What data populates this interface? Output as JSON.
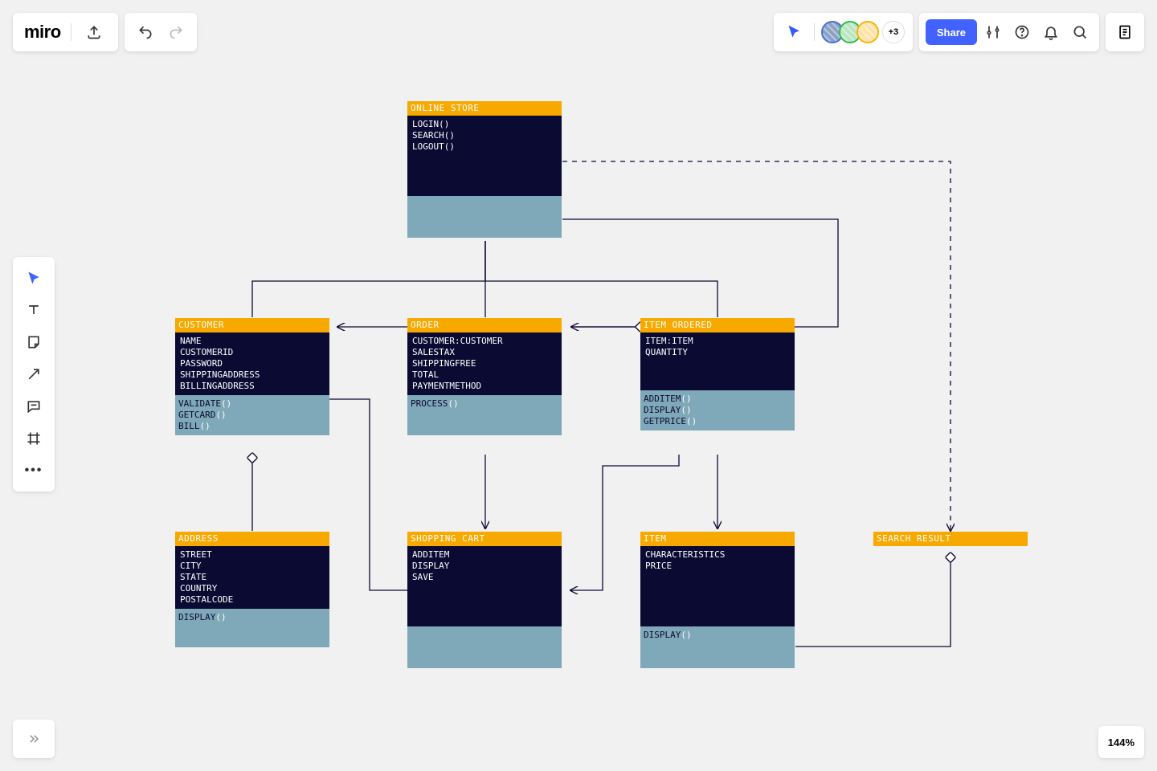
{
  "app": {
    "logo": "miro"
  },
  "presence": {
    "overflow": "+3"
  },
  "share": {
    "label": "Share"
  },
  "zoom": {
    "level": "144%"
  },
  "boxes": {
    "online_store": {
      "title": "ONLINE STORE",
      "attrs": [
        "LOGIN()",
        "SEARCH()",
        "LOGOUT()"
      ],
      "methods": []
    },
    "customer": {
      "title": "CUSTOMER",
      "attrs": [
        "NAME",
        "CUSTOMERID",
        "PASSWORD",
        "SHIPPINGADDRESS",
        "BILLINGADDRESS"
      ],
      "methods": [
        "VALIDATE()",
        "GETCARD()",
        "BILL()"
      ]
    },
    "order": {
      "title": "ORDER",
      "attrs": [
        "CUSTOMER:CUSTOMER",
        "SALESTAX",
        "SHIPPINGFREE",
        "TOTAL",
        "PAYMENTMETHOD"
      ],
      "methods": [
        "PROCESS()"
      ]
    },
    "item_ordered": {
      "title": "ITEM ORDERED",
      "attrs": [
        "ITEM:ITEM",
        "QUANTITY"
      ],
      "methods": [
        "ADDITEM()",
        "DISPLAY()",
        "GETPRICE()"
      ]
    },
    "address": {
      "title": "ADDRESS",
      "attrs": [
        "STREET",
        "CITY",
        "STATE",
        "COUNTRY",
        "POSTALCODE"
      ],
      "methods": [
        "DISPLAY()"
      ]
    },
    "shopping_cart": {
      "title": "SHOPPING CART",
      "attrs": [
        "ADDITEM",
        "DISPLAY",
        "SAVE"
      ],
      "methods": []
    },
    "item": {
      "title": "ITEM",
      "attrs": [
        "CHARACTERISTICS",
        "PRICE"
      ],
      "methods": [
        "DISPLAY()"
      ]
    },
    "search_result": {
      "title": "SEARCH RESULT",
      "attrs": [],
      "methods": []
    }
  }
}
